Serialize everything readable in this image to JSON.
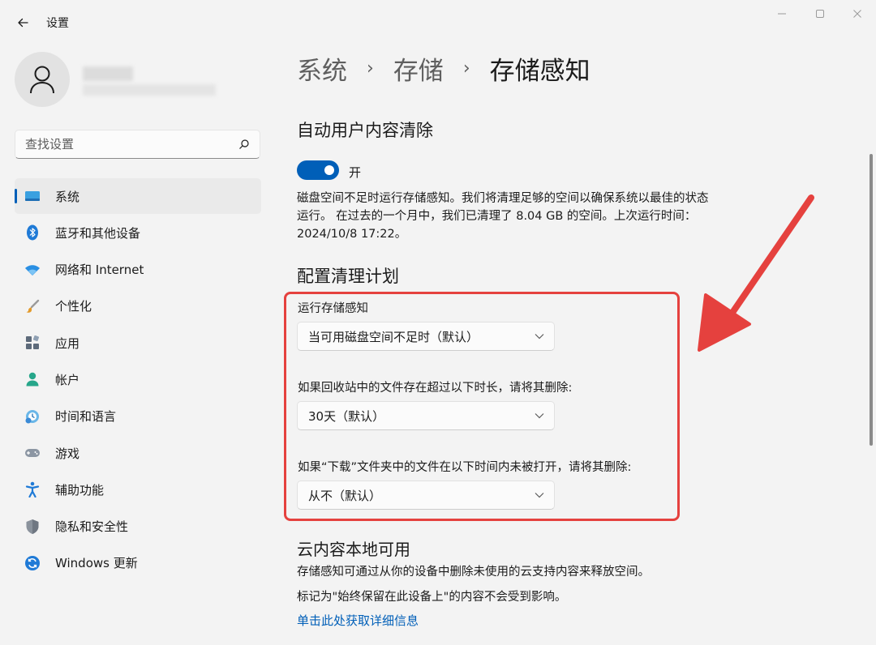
{
  "window": {
    "title": "设置",
    "controls": [
      "minimize-icon",
      "maximize-icon",
      "close-icon"
    ]
  },
  "search": {
    "placeholder": "查找设置"
  },
  "sidebar": {
    "items": [
      {
        "label": "系统",
        "icon": "system-icon",
        "active": true
      },
      {
        "label": "蓝牙和其他设备",
        "icon": "bluetooth-icon"
      },
      {
        "label": "网络和 Internet",
        "icon": "wifi-icon"
      },
      {
        "label": "个性化",
        "icon": "brush-icon"
      },
      {
        "label": "应用",
        "icon": "apps-icon"
      },
      {
        "label": "帐户",
        "icon": "account-icon"
      },
      {
        "label": "时间和语言",
        "icon": "time-language-icon"
      },
      {
        "label": "游戏",
        "icon": "gamepad-icon"
      },
      {
        "label": "辅助功能",
        "icon": "accessibility-icon"
      },
      {
        "label": "隐私和安全性",
        "icon": "shield-icon"
      },
      {
        "label": "Windows 更新",
        "icon": "update-icon"
      }
    ]
  },
  "breadcrumb": {
    "level1": "系统",
    "level2": "存储",
    "current": "存储感知"
  },
  "auto_cleanup": {
    "heading": "自动用户内容清除",
    "toggle_label": "开",
    "description": "磁盘空间不足时运行存储感知。我们将清理足够的空间以确保系统以最佳的状态运行。 在过去的一个月中，我们已清理了 8.04 GB 的空间。上次运行时间：2024/10/8 17:22。"
  },
  "schedule": {
    "heading": "配置清理计划",
    "run_label": "运行存储感知",
    "run_value": "当可用磁盘空间不足时（默认）",
    "recycle_label": "如果回收站中的文件存在超过以下时长，请将其删除:",
    "recycle_value": "30天（默认）",
    "downloads_label": "如果“下载”文件夹中的文件在以下时间内未被打开，请将其删除:",
    "downloads_value": "从不（默认）"
  },
  "cloud": {
    "heading": "云内容本地可用",
    "line1": "存储感知可通过从你的设备中删除未使用的云支持内容来释放空间。",
    "line2": "标记为\"始终保留在此设备上\"的内容不会受到影响。",
    "link": "单击此处获取详细信息"
  },
  "colors": {
    "accent": "#005fb8",
    "annotation": "#e5413e"
  }
}
